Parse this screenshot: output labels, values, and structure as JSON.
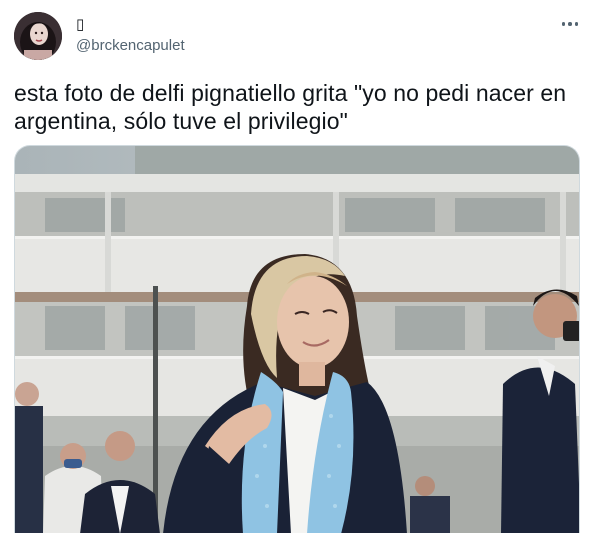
{
  "tweet": {
    "display_name": " ",
    "display_name_glyph": "tofu",
    "handle": "@brckencapulet",
    "text": "esta foto de delfi pignatiello grita \"yo no pedi nacer en\nargentina, sólo tuve el privilegio\"",
    "more_icon": "more-horizontal-icon"
  },
  "colors": {
    "text_primary": "#0f1419",
    "text_secondary": "#536471",
    "border": "#cfd9de",
    "scarf": "#8fc3e3",
    "jacket": "#1a2236"
  }
}
